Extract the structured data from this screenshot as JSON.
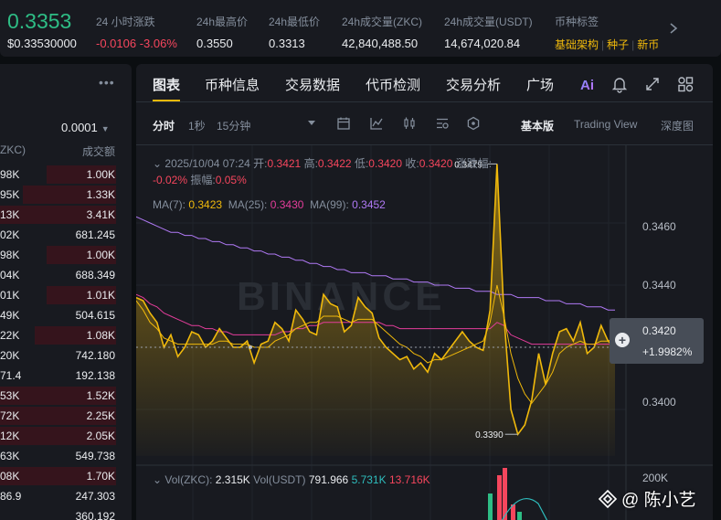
{
  "ticker": {
    "last_price": "0.3353",
    "usd_price": "$0.33530000",
    "stats": [
      {
        "label": "24 小时涨跌",
        "value": "-0.0106 -3.06%"
      },
      {
        "label": "24h最高价",
        "value": "0.3550"
      },
      {
        "label": "24h最低价",
        "value": "0.3313"
      },
      {
        "label": "24h成交量(ZKC)",
        "value": "42,840,488.50"
      },
      {
        "label": "24h成交量(USDT)",
        "value": "14,674,020.84"
      },
      {
        "label": "币种标签",
        "value": ""
      }
    ],
    "tags": [
      "基础架构",
      "种子",
      "新币"
    ]
  },
  "orderbook": {
    "precision": "0.0001",
    "col_price_header": "ZKC)",
    "col_amount_header": "成交额",
    "rows": [
      {
        "p": "98K",
        "a": "1.00K",
        "depth": 0.6
      },
      {
        "p": "95K",
        "a": "1.33K",
        "depth": 0.8
      },
      {
        "p": "13K",
        "a": "3.41K",
        "depth": 1.0
      },
      {
        "p": "02K",
        "a": "681.245",
        "depth": 0.0
      },
      {
        "p": "98K",
        "a": "1.00K",
        "depth": 0.6
      },
      {
        "p": "04K",
        "a": "688.349",
        "depth": 0.0
      },
      {
        "p": "01K",
        "a": "1.01K",
        "depth": 0.6
      },
      {
        "p": "49K",
        "a": "504.615",
        "depth": 0.0
      },
      {
        "p": "22K",
        "a": "1.08K",
        "depth": 0.7
      },
      {
        "p": "20K",
        "a": "742.180",
        "depth": 0.0
      },
      {
        "p": "71.4",
        "a": "192.138",
        "depth": 0.0
      },
      {
        "p": "53K",
        "a": "1.52K",
        "depth": 1.0
      },
      {
        "p": "72K",
        "a": "2.25K",
        "depth": 1.0
      },
      {
        "p": "12K",
        "a": "2.05K",
        "depth": 1.0
      },
      {
        "p": "63K",
        "a": "549.738",
        "depth": 0.0
      },
      {
        "p": "08K",
        "a": "1.70K",
        "depth": 1.0
      },
      {
        "p": "86.9",
        "a": "247.303",
        "depth": 0.0
      },
      {
        "p": "",
        "a": "360.192",
        "depth": 0.0
      }
    ]
  },
  "tabs": [
    "图表",
    "币种信息",
    "交易数据",
    "代币检测",
    "交易分析",
    "广场"
  ],
  "toolbar": {
    "intervals": [
      "分时",
      "1秒",
      "15分钟"
    ],
    "views": [
      "基本版",
      "Trading View",
      "深度图"
    ]
  },
  "chart": {
    "ohlc": {
      "date": "2025/10/04 07:24",
      "open_label": "开:",
      "open": "0.3421",
      "high_label": "高:",
      "high": "0.3422",
      "low_label": "低:",
      "low": "0.3420",
      "close_label": "收:",
      "close": "0.3420",
      "chg_label": "涨跌幅:",
      "chg": "-0.02%",
      "amp_label": "振幅:",
      "amp": "0.05%"
    },
    "ma": {
      "ma7_label": "MA(7):",
      "ma7": "0.3423",
      "ma25_label": "MA(25):",
      "ma25": "0.3430",
      "ma99_label": "MA(99):",
      "ma99": "0.3452"
    },
    "y_labels": [
      "0.3460",
      "0.3440",
      "0.3400"
    ],
    "price_tag": {
      "price": "0.3420",
      "change": "+1.9982%"
    },
    "high_marker": "0.3479",
    "low_marker": "0.3390",
    "watermark": "BINANCE",
    "volume": {
      "label": "Vol(ZKC):",
      "zkc": "2.315K",
      "usdt_label": "Vol(USDT)",
      "usdt": "791.966",
      "ma5": "5.731K",
      "ma10": "13.716K",
      "axis_label": "200K"
    },
    "colors": {
      "line": "#f0b90b",
      "ma25": "#e33d9a",
      "ma99": "#b079f5",
      "up": "#2ebd85",
      "down": "#f6465d"
    }
  },
  "chart_data": {
    "type": "area",
    "ylim": [
      0.3385,
      0.3485
    ],
    "y_ticks": [
      0.346,
      0.344,
      0.34
    ],
    "series": [
      {
        "values": [
          0.3436,
          0.3435,
          0.3431,
          0.3428,
          0.342,
          0.3424,
          0.3417,
          0.342,
          0.3425,
          0.3424,
          0.342,
          0.3422,
          0.3426,
          0.3423,
          0.342,
          0.342,
          0.3422,
          0.3415,
          0.3421,
          0.3422,
          0.3428,
          0.3426,
          0.3422,
          0.3432,
          0.3429,
          0.3425,
          0.3424,
          0.3437,
          0.3434,
          0.3433,
          0.3425,
          0.3427,
          0.3436,
          0.3433,
          0.3431,
          0.3423,
          0.342,
          0.3418,
          0.3416,
          0.3417,
          0.3413,
          0.3415,
          0.3412,
          0.3418,
          0.3416,
          0.3419,
          0.3422,
          0.3425,
          0.3422,
          0.342,
          0.3419,
          0.3432,
          0.3479,
          0.343,
          0.34,
          0.3392,
          0.3395,
          0.3403,
          0.3418,
          0.3408,
          0.3418,
          0.3425,
          0.3426,
          0.3422,
          0.3428,
          0.3418,
          0.342,
          0.3427,
          0.3422,
          0.342
        ]
      },
      {
        "values": [
          0.3435,
          0.3432,
          0.3428,
          0.3426,
          0.3423,
          0.3422,
          0.3421,
          0.3421,
          0.3421,
          0.3421,
          0.3421,
          0.3421,
          0.3422,
          0.3422,
          0.3421,
          0.3421,
          0.3421,
          0.342,
          0.342,
          0.342,
          0.3422,
          0.3423,
          0.3424,
          0.3426,
          0.3427,
          0.3428,
          0.3428,
          0.343,
          0.343,
          0.343,
          0.3429,
          0.3428,
          0.3429,
          0.3429,
          0.3429,
          0.3427,
          0.3425,
          0.3423,
          0.3421,
          0.342,
          0.3418,
          0.3417,
          0.3415,
          0.3416,
          0.3416,
          0.3417,
          0.3418,
          0.3419,
          0.342,
          0.3421,
          0.3422,
          0.3428,
          0.344,
          0.343,
          0.3418,
          0.341,
          0.3405,
          0.3402,
          0.3405,
          0.3408,
          0.3412,
          0.3418,
          0.342,
          0.3421,
          0.3422,
          0.3421,
          0.3421,
          0.3422,
          0.3422,
          0.3423
        ]
      },
      {
        "values": [
          0.3437,
          0.3436,
          0.3434,
          0.3433,
          0.3431,
          0.343,
          0.3429,
          0.3428,
          0.3427,
          0.3427,
          0.3426,
          0.3426,
          0.3425,
          0.3425,
          0.3424,
          0.3424,
          0.3424,
          0.3424,
          0.3424,
          0.3424,
          0.3424,
          0.3425,
          0.3425,
          0.3426,
          0.3426,
          0.3427,
          0.3427,
          0.3428,
          0.3428,
          0.3428,
          0.3428,
          0.3428,
          0.3428,
          0.3428,
          0.3428,
          0.3428,
          0.3427,
          0.3427,
          0.3426,
          0.3426,
          0.3426,
          0.3426,
          0.3426,
          0.3426,
          0.3426,
          0.3426,
          0.3426,
          0.3426,
          0.3426,
          0.3426,
          0.3426,
          0.3426,
          0.3428,
          0.3427,
          0.3424,
          0.3423,
          0.3422,
          0.3421,
          0.3421,
          0.3421,
          0.3421,
          0.3421,
          0.3421,
          0.3421,
          0.3421,
          0.3421,
          0.3421,
          0.3421,
          0.3421,
          0.3421
        ]
      },
      {
        "values": [
          0.3462,
          0.3461,
          0.346,
          0.3459,
          0.3458,
          0.3457,
          0.3457,
          0.3456,
          0.3456,
          0.3455,
          0.3455,
          0.3454,
          0.3454,
          0.3453,
          0.3453,
          0.3452,
          0.3452,
          0.3451,
          0.3451,
          0.345,
          0.345,
          0.3449,
          0.3449,
          0.3448,
          0.3448,
          0.3447,
          0.3447,
          0.3446,
          0.3446,
          0.3445,
          0.3445,
          0.3444,
          0.3444,
          0.3444,
          0.3443,
          0.3443,
          0.3443,
          0.3442,
          0.3442,
          0.3442,
          0.3441,
          0.3441,
          0.3441,
          0.344,
          0.344,
          0.344,
          0.3439,
          0.3439,
          0.3439,
          0.3438,
          0.3438,
          0.3438,
          0.3437,
          0.3437,
          0.3437,
          0.3436,
          0.3436,
          0.3436,
          0.3436,
          0.3435,
          0.3435,
          0.3435,
          0.3434,
          0.3434,
          0.3434,
          0.3433,
          0.3433,
          0.3433,
          0.3432,
          0.3432
        ]
      }
    ]
  }
}
